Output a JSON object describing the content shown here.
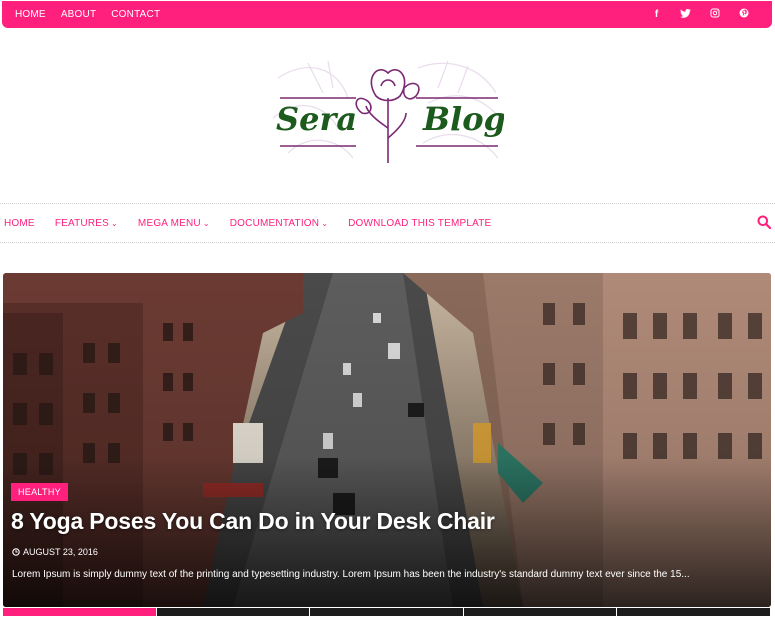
{
  "topbar": {
    "links": [
      "HOME",
      "ABOUT",
      "CONTACT"
    ],
    "social_icons": [
      "facebook-icon",
      "twitter-icon",
      "instagram-icon",
      "pinterest-icon"
    ]
  },
  "logo": {
    "text_left": "Sera",
    "text_right": "Blog"
  },
  "mainnav": {
    "items": [
      {
        "label": "HOME",
        "dropdown": false
      },
      {
        "label": "FEATURES",
        "dropdown": true
      },
      {
        "label": "MEGA MENU",
        "dropdown": true
      },
      {
        "label": "DOCUMENTATION",
        "dropdown": true
      },
      {
        "label": "DOWNLOAD THIS TEMPLATE",
        "dropdown": false
      }
    ]
  },
  "featured": {
    "tag": "HEALTHY",
    "title": "8 Yoga Poses You Can Do in Your Desk Chair",
    "date": "AUGUST 23, 2016",
    "excerpt": "Lorem Ipsum is simply dummy text of the printing and typesetting industry. Lorem Ipsum has been the industry's standard dummy text ever since the 15..."
  },
  "colors": {
    "accent": "#ff1f7c",
    "logo_green": "#1d5a1d",
    "logo_purple": "#7a2a74"
  }
}
